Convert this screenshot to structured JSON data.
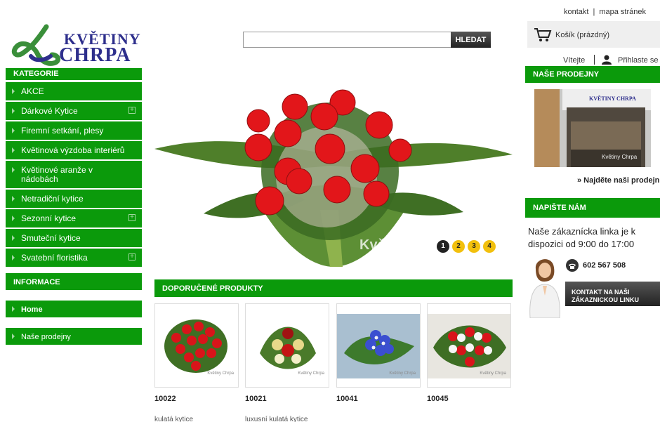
{
  "logo": {
    "line1": "KVĚTINY",
    "line2": "CHRPA"
  },
  "search": {
    "placeholder": "",
    "button_label": "HLEDAT"
  },
  "toplinks": {
    "contact": "kontakt",
    "sitemap": "mapa stránek"
  },
  "cart": {
    "label": "Košík (prázdný)"
  },
  "user": {
    "welcome": "Vítejte",
    "login": "Přihlaste se"
  },
  "categories": {
    "title": "KATEGORIE",
    "items": [
      {
        "label": "AKCE",
        "expandable": false
      },
      {
        "label": "Dárkové Kytice",
        "expandable": true
      },
      {
        "label": "Firemní setkání, plesy",
        "expandable": false
      },
      {
        "label": "Květinová výzdoba interiérů",
        "expandable": false
      },
      {
        "label": "Květinové aranže v nádobách",
        "expandable": false
      },
      {
        "label": "Netradiční kytice",
        "expandable": false
      },
      {
        "label": "Sezonní kytice",
        "expandable": true
      },
      {
        "label": "Smuteční kytice",
        "expandable": false
      },
      {
        "label": "Svatební floristika",
        "expandable": true
      }
    ]
  },
  "information": {
    "title": "INFORMACE",
    "home": "Home",
    "shops": "Naše prodejny"
  },
  "slider": {
    "watermark": "Květiny Chrpa",
    "pages": [
      "1",
      "2",
      "3",
      "4"
    ],
    "active_page": 1
  },
  "products": {
    "title": "DOPORUČENÉ PRODUKTY",
    "items": [
      {
        "code": "10022",
        "name": "kulatá kytice",
        "watermark": "Květiny Chrpa"
      },
      {
        "code": "10021",
        "name": "luxusní kulatá kytice",
        "watermark": "Květiny Chrpa"
      },
      {
        "code": "10041",
        "name": "",
        "watermark": "Květiny Chrpa"
      },
      {
        "code": "10045",
        "name": "",
        "watermark": "Květiny Chrpa"
      }
    ]
  },
  "shops_panel": {
    "title": "NAŠE PRODEJNY",
    "link": "» Najděte naši prodejnu",
    "photo_sign": "KVĚTINY CHRPA",
    "photo_watermark": "Květiny Chrpa"
  },
  "write_panel": {
    "title": "NAPIŠTE NÁM",
    "text": "Naše zákaznícka linka je k dispozici od 9:00 do 17:00",
    "phone": "602 567 508",
    "button_line1": "KONTAKT NA NAŠI",
    "button_line2": "ZÁKAZNICKOU LINKU"
  },
  "colors": {
    "green": "#0b9a0b",
    "logo_blue": "#2e2f8c",
    "logo_green": "#3a8f3a",
    "dot_yellow": "#f2c00d"
  }
}
